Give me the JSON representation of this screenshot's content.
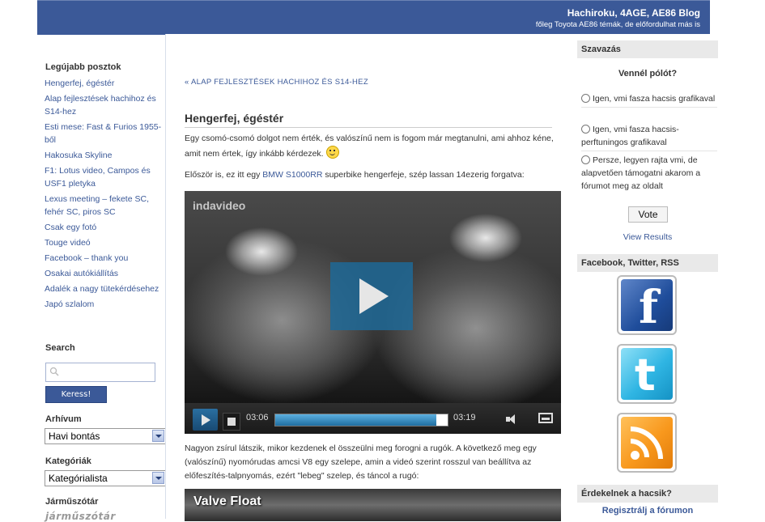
{
  "header": {
    "title": "Hachiroku, 4AGE, AE86 Blog",
    "tagline": "főleg Toyota AE86 témák, de előfordulhat más is"
  },
  "left_sidebar": {
    "recent_title": "Legújabb posztok",
    "recent_posts": [
      "Hengerfej, égéstér",
      "Alap fejlesztések hachihoz és S14-hez",
      "Esti mese: Fast & Furios 1955-ből",
      "Hakosuka Skyline",
      "F1: Lotus video, Campos és USF1 pletyka",
      "Lexus meeting – fekete SC, fehér SC, piros SC",
      "Csak egy fotó",
      "Touge videó",
      "Facebook – thank you",
      "Osakai autókiállítás",
      "Adalék a nagy tütekérdésehez",
      "Japó szlalom"
    ],
    "search_title": "Search",
    "search_placeholder": "",
    "search_button": "Keress!",
    "archive_title": "Arhívum",
    "archive_selected": "Havi bontás",
    "categories_title": "Kategóriák",
    "categories_selected": "Kategórialista",
    "vehicle_dict_title": "Járműszótár",
    "vehicle_dict_logo": "járműszótár"
  },
  "main": {
    "back_link": "« ALAP FEJLESZTÉSEK HACHIHOZ ÉS S14-HEZ",
    "post_title": "Hengerfej, égéstér",
    "para1": "Egy csomó-csomó dolgot nem érték, és valószínű nem is fogom már megtanulni, ami ahhoz kéne, amit nem értek, így inkább kérdezek.",
    "para2_before": "Először is, ez itt egy ",
    "para2_link": "BMW S1000RR",
    "para2_after": " superbike hengerfeje, szép lassan 14ezerig forgatva:",
    "video": {
      "logo": "indavideo",
      "time_current": "03:06",
      "time_total": "03:19",
      "progress": 0.935
    },
    "para3": "Nagyon zsírul látszik, mikor kezdenek el összeülni meg forogni a rugók. A következő meg egy (valószínű) nyomórudas amcsi V8 egy szelepe, amin a videó szerint rosszul van beállítva az előfeszítés-talpnyomás, ezért \"lebeg\" szelep, és táncol a rugó:",
    "video2_title": "Valve Float"
  },
  "right_sidebar": {
    "poll_title": "Szavazás",
    "poll_question": "Vennél pólót?",
    "poll_options": [
      "Igen, vmi fasza hacsis grafikaval",
      "Igen, vmi fasza hacsis-perftuningos grafikaval",
      "Persze, legyen rajta vmi, de alapvetően támogatni akarom a fórumot meg az oldalt"
    ],
    "vote_button": "Vote",
    "view_results": "View Results",
    "social_title": "Facebook, Twitter, RSS",
    "fb_glyph": "f",
    "tw_glyph": "t",
    "interest_title": "Érdekelnek a hacsik?",
    "register_link": "Regisztrálj a fórumon"
  },
  "colors": {
    "brand": "#3b5998",
    "player_accent": "#1f6ea1"
  }
}
